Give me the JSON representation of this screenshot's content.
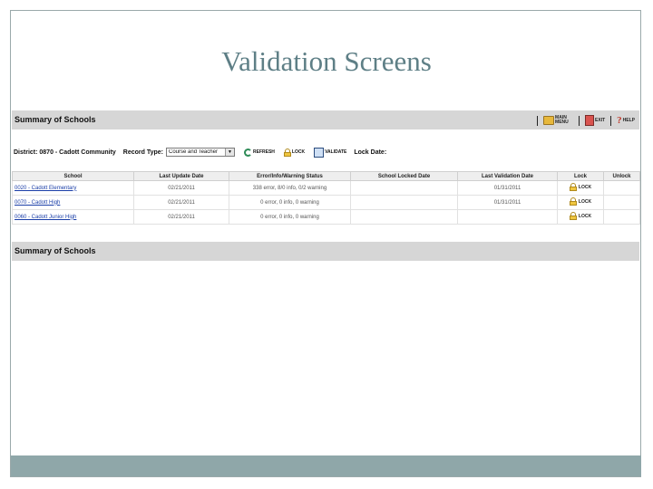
{
  "slide": {
    "title": "Validation Screens"
  },
  "panel": {
    "title": "Summary of Schools",
    "nav": {
      "main_menu": "MAIN MENU",
      "exit": "EXIT",
      "help": "HELP"
    }
  },
  "filters": {
    "district": "District: 0870 - Cadott Community",
    "record_type_label": "Record Type:",
    "record_type_value": "Course and Teacher",
    "refresh": "REFRESH",
    "lock": "LOCK",
    "validate": "VALIDATE",
    "lock_date_label": "Lock Date:"
  },
  "table": {
    "headers": [
      "School",
      "Last Update Date",
      "Error/Info/Warning Status",
      "School Locked Date",
      "Last Validation Date",
      "Lock",
      "Unlock"
    ],
    "rows": [
      {
        "school": "0020 - Cadott Elementary",
        "last_update": "02/21/2011",
        "status": "338 error, 8/0 info, 0/2 warning",
        "locked_date": "",
        "last_validation": "01/31/2011",
        "lock": "LOCK",
        "unlock": ""
      },
      {
        "school": "0070 - Cadott High",
        "last_update": "02/21/2011",
        "status": "0 error, 0 info, 0 warning",
        "locked_date": "",
        "last_validation": "01/31/2011",
        "lock": "LOCK",
        "unlock": ""
      },
      {
        "school": "0060 - Cadott Junior High",
        "last_update": "02/21/2011",
        "status": "0 error, 0 info, 0 warning",
        "locked_date": "",
        "last_validation": "",
        "lock": "LOCK",
        "unlock": ""
      }
    ]
  },
  "panel2": {
    "title": "Summary of Schools"
  }
}
